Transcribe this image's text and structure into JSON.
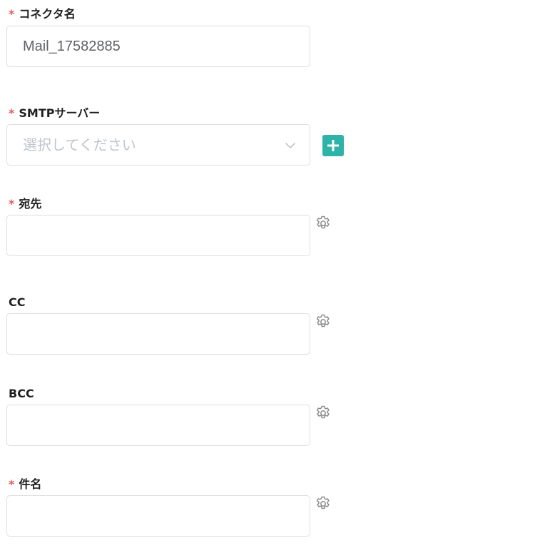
{
  "form": {
    "required_mark": "*",
    "connector_name": {
      "label": "コネクタ名",
      "value": "Mail_17582885"
    },
    "smtp_server": {
      "label": "SMTPサーバー",
      "placeholder": "選択してください"
    },
    "to": {
      "label": "宛先",
      "value": ""
    },
    "cc": {
      "label": "CC",
      "value": ""
    },
    "bcc": {
      "label": "BCC",
      "value": ""
    },
    "subject": {
      "label": "件名",
      "value": ""
    }
  },
  "icons": {
    "add": "plus-icon",
    "settings": "gear-icon",
    "dropdown": "chevron-down-icon"
  },
  "colors": {
    "required": "#e25b5b",
    "accent": "#2eb3a8",
    "border": "#dcdfe6",
    "placeholder": "#c0c4cc",
    "icon": "#8c8c8c"
  }
}
